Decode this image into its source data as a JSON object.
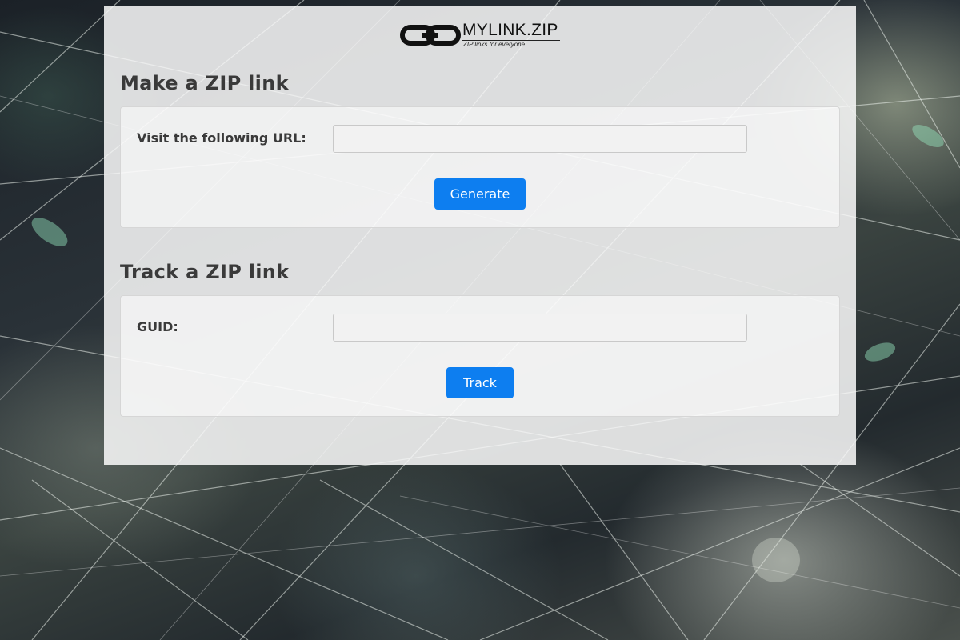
{
  "logo": {
    "name": "MYLINK.ZIP",
    "tagline": "ZIP links for everyone"
  },
  "make_section": {
    "title": "Make a ZIP link",
    "url_label": "Visit the following URL:",
    "url_value": "",
    "button_label": "Generate"
  },
  "track_section": {
    "title": "Track a ZIP link",
    "guid_label": "GUID:",
    "guid_value": "",
    "button_label": "Track"
  },
  "colors": {
    "button": "#0d7ef0",
    "panel": "#fafafa",
    "heading": "#3a3a3a"
  },
  "icons": {
    "logo": "chain-link-icon"
  }
}
